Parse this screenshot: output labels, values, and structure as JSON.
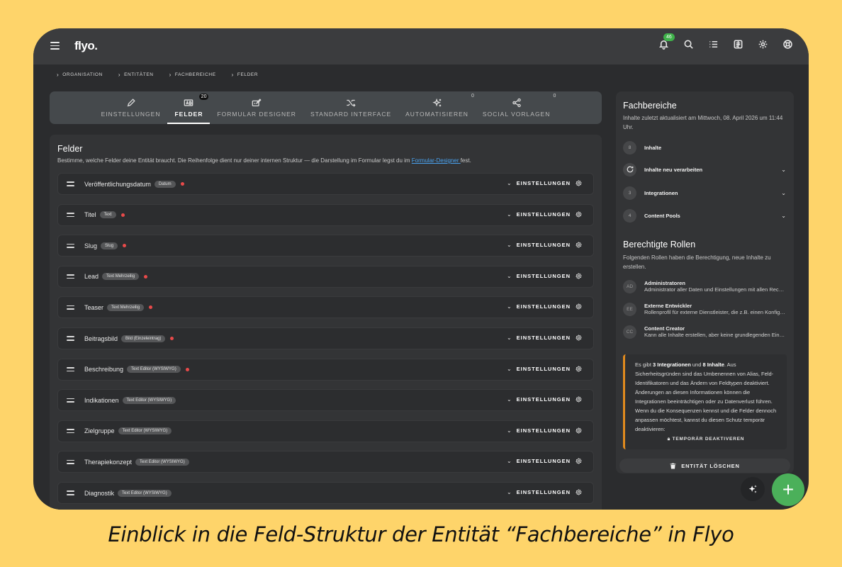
{
  "app": {
    "logo": "flyo."
  },
  "topbar": {
    "notification_count": "46"
  },
  "breadcrumb": [
    "ORGANISATION",
    "ENTITÄTEN",
    "FACHBEREICHE",
    "FELDER"
  ],
  "tabs": [
    {
      "label": "EINSTELLUNGEN",
      "icon": "pencil-icon",
      "count": ""
    },
    {
      "label": "FELDER",
      "icon": "text-field-icon",
      "count": "20"
    },
    {
      "label": "FORMULAR DESIGNER",
      "icon": "form-edit-icon",
      "count": ""
    },
    {
      "label": "STANDARD INTERFACE",
      "icon": "shuffle-icon",
      "count": ""
    },
    {
      "label": "AUTOMATISIEREN",
      "icon": "sparkles-icon",
      "count": "0"
    },
    {
      "label": "SOCIAL VORLAGEN",
      "icon": "share-icon",
      "count": "0"
    }
  ],
  "fields": {
    "title": "Felder",
    "description_prefix": "Bestimme, welche Felder deine Entität braucht. Die Reihenfolge dient nur deiner internen Struktur — die Darstellung im Formular legst du im ",
    "description_link": "Formular-Designer ",
    "description_suffix": "fest.",
    "settings_label": "EINSTELLUNGEN",
    "rows": [
      {
        "name": "Veröffentlichungsdatum",
        "type": "Datum",
        "required": true
      },
      {
        "name": "Titel",
        "type": "Text",
        "required": true
      },
      {
        "name": "Slug",
        "type": "Slug",
        "required": true
      },
      {
        "name": "Lead",
        "type": "Text Mehrzeilig",
        "required": true
      },
      {
        "name": "Teaser",
        "type": "Text Mehrzeilig",
        "required": true
      },
      {
        "name": "Beitragsbild",
        "type": "Bild (Einzeleintrag)",
        "required": true
      },
      {
        "name": "Beschreibung",
        "type": "Text Editor (WYSIWYG)",
        "required": true
      },
      {
        "name": "Indikationen",
        "type": "Text Editor (WYSIWYG)",
        "required": false
      },
      {
        "name": "Zielgruppe",
        "type": "Text Editor (WYSIWYG)",
        "required": false
      },
      {
        "name": "Therapiekonzept",
        "type": "Text Editor (WYSIWYG)",
        "required": false
      },
      {
        "name": "Diagnostik",
        "type": "Text Editor (WYSIWYG)",
        "required": false
      }
    ]
  },
  "side": {
    "title": "Fachbereiche",
    "subtitle": "Inhalte zuletzt aktualisiert am Mittwoch, 08. April 2026 um 11:44 Uhr.",
    "meta": [
      {
        "circle": "8",
        "label": "Inhalte",
        "expandable": false
      },
      {
        "circle": "",
        "label": "Inhalte neu verarbeiten",
        "expandable": true,
        "icon": "refresh-icon"
      },
      {
        "circle": "3",
        "label": "Integrationen",
        "expandable": true
      },
      {
        "circle": "4",
        "label": "Content Pools",
        "expandable": true
      }
    ],
    "roles_title": "Berechtigte Rollen",
    "roles_subtitle": "Folgenden Rollen haben die Berechtigung, neue Inhalte zu erstellen.",
    "roles": [
      {
        "initials": "AD",
        "name": "Administratoren",
        "desc": "Administrator aller Daten und Einstellungen mit allen Rechten"
      },
      {
        "initials": "EE",
        "name": "Externe Entwickler",
        "desc": "Rollenprofil für externe Dienstleister, die z.B. einen Konfigurationszugang benötigen"
      },
      {
        "initials": "CC",
        "name": "Content Creator",
        "desc": "Kann alle Inhalte erstellen, aber keine grundlegenden Einstellungen ändern"
      }
    ],
    "warning": {
      "p1": "Es gibt ",
      "b1": "3 Integrationen",
      "p2": " und ",
      "b2": "8 Inhalte",
      "p3": ". Aus Sicherheitsgründen sind das Umbenennen von Alias, Feld-Identifikatoren und das Ändern von Feldtypen deaktiviert. Änderungen an diesen Informationen können die Integrationen beeinträchtigen oder zu Datenverlust führen. Wenn du die Konsequenzen kennst und die Felder dennoch anpassen möchtest, kannst du diesen Schutz temporär deaktivieren:",
      "button": "TEMPORÄR DEAKTIVEREN"
    },
    "delete_button": "ENTITÄT LÖSCHEN"
  },
  "caption": "Einblick in die Feld-Struktur der Entität “Fachbereiche” in Flyo",
  "colors": {
    "background": "#fed46a",
    "accent_green": "#4bb05a",
    "required_dot": "#e84a4a",
    "warning_border": "#e08a1e"
  }
}
